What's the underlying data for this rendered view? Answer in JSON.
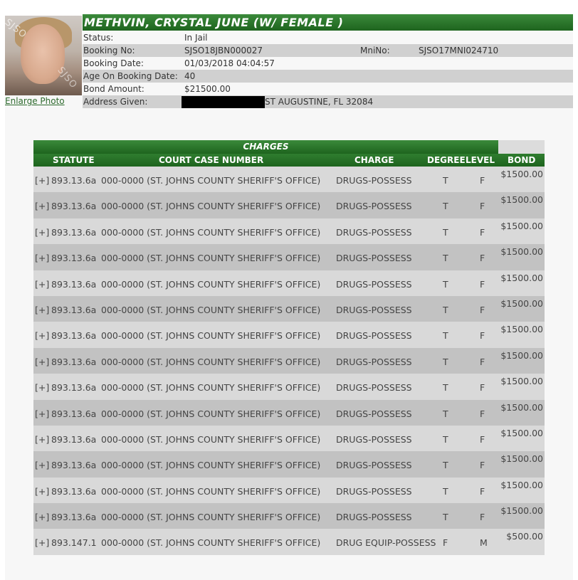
{
  "inmate": {
    "name_header": "METHVIN, CRYSTAL JUNE   (W/ FEMALE )",
    "enlarge_link": "Enlarge Photo",
    "photo_watermark_1": "SJSO",
    "photo_watermark_2": "SJSO",
    "fields": {
      "status_label": "Status:",
      "status_value": "In Jail",
      "booking_no_label": "Booking No:",
      "booking_no_value": "SJSO18JBN000027",
      "mni_label": "MniNo:",
      "mni_value": "SJSO17MNI024710",
      "booking_date_label": "Booking Date:",
      "booking_date_value": "01/03/2018 04:04:57",
      "age_label": "Age On Booking Date:",
      "age_value": "40",
      "bond_label": "Bond Amount:",
      "bond_value": "$21500.00",
      "address_label": "Address Given:",
      "address_value": "ST AUGUSTINE, FL 32084"
    }
  },
  "charges": {
    "title": "CHARGES",
    "headers": {
      "statute": "STATUTE",
      "case": "COURT CASE NUMBER",
      "charge": "CHARGE",
      "degree": "DEGREE",
      "level": "LEVEL",
      "bond": "BOND"
    },
    "rows": [
      {
        "toggle": "[+]",
        "statute": "893.13.6a",
        "case": "000-0000 (ST. JOHNS COUNTY SHERIFF'S OFFICE)",
        "charge": "DRUGS-POSSESS",
        "degree": "T",
        "level": "F",
        "bond": "$1500.00"
      },
      {
        "toggle": "[+]",
        "statute": "893.13.6a",
        "case": "000-0000 (ST. JOHNS COUNTY SHERIFF'S OFFICE)",
        "charge": "DRUGS-POSSESS",
        "degree": "T",
        "level": "F",
        "bond": "$1500.00"
      },
      {
        "toggle": "[+]",
        "statute": "893.13.6a",
        "case": "000-0000 (ST. JOHNS COUNTY SHERIFF'S OFFICE)",
        "charge": "DRUGS-POSSESS",
        "degree": "T",
        "level": "F",
        "bond": "$1500.00"
      },
      {
        "toggle": "[+]",
        "statute": "893.13.6a",
        "case": "000-0000 (ST. JOHNS COUNTY SHERIFF'S OFFICE)",
        "charge": "DRUGS-POSSESS",
        "degree": "T",
        "level": "F",
        "bond": "$1500.00"
      },
      {
        "toggle": "[+]",
        "statute": "893.13.6a",
        "case": "000-0000 (ST. JOHNS COUNTY SHERIFF'S OFFICE)",
        "charge": "DRUGS-POSSESS",
        "degree": "T",
        "level": "F",
        "bond": "$1500.00"
      },
      {
        "toggle": "[+]",
        "statute": "893.13.6a",
        "case": "000-0000 (ST. JOHNS COUNTY SHERIFF'S OFFICE)",
        "charge": "DRUGS-POSSESS",
        "degree": "T",
        "level": "F",
        "bond": "$1500.00"
      },
      {
        "toggle": "[+]",
        "statute": "893.13.6a",
        "case": "000-0000 (ST. JOHNS COUNTY SHERIFF'S OFFICE)",
        "charge": "DRUGS-POSSESS",
        "degree": "T",
        "level": "F",
        "bond": "$1500.00"
      },
      {
        "toggle": "[+]",
        "statute": "893.13.6a",
        "case": "000-0000 (ST. JOHNS COUNTY SHERIFF'S OFFICE)",
        "charge": "DRUGS-POSSESS",
        "degree": "T",
        "level": "F",
        "bond": "$1500.00"
      },
      {
        "toggle": "[+]",
        "statute": "893.13.6a",
        "case": "000-0000 (ST. JOHNS COUNTY SHERIFF'S OFFICE)",
        "charge": "DRUGS-POSSESS",
        "degree": "T",
        "level": "F",
        "bond": "$1500.00"
      },
      {
        "toggle": "[+]",
        "statute": "893.13.6a",
        "case": "000-0000 (ST. JOHNS COUNTY SHERIFF'S OFFICE)",
        "charge": "DRUGS-POSSESS",
        "degree": "T",
        "level": "F",
        "bond": "$1500.00"
      },
      {
        "toggle": "[+]",
        "statute": "893.13.6a",
        "case": "000-0000 (ST. JOHNS COUNTY SHERIFF'S OFFICE)",
        "charge": "DRUGS-POSSESS",
        "degree": "T",
        "level": "F",
        "bond": "$1500.00"
      },
      {
        "toggle": "[+]",
        "statute": "893.13.6a",
        "case": "000-0000 (ST. JOHNS COUNTY SHERIFF'S OFFICE)",
        "charge": "DRUGS-POSSESS",
        "degree": "T",
        "level": "F",
        "bond": "$1500.00"
      },
      {
        "toggle": "[+]",
        "statute": "893.13.6a",
        "case": "000-0000 (ST. JOHNS COUNTY SHERIFF'S OFFICE)",
        "charge": "DRUGS-POSSESS",
        "degree": "T",
        "level": "F",
        "bond": "$1500.00"
      },
      {
        "toggle": "[+]",
        "statute": "893.13.6a",
        "case": "000-0000 (ST. JOHNS COUNTY SHERIFF'S OFFICE)",
        "charge": "DRUGS-POSSESS",
        "degree": "T",
        "level": "F",
        "bond": "$1500.00"
      },
      {
        "toggle": "[+]",
        "statute": "893.147.1",
        "case": "000-0000 (ST. JOHNS COUNTY SHERIFF'S OFFICE)",
        "charge": "DRUG EQUIP-POSSESS",
        "degree": "F",
        "level": "M",
        "bond": "$500.00"
      }
    ]
  },
  "colors": {
    "header_green": "#1e641e",
    "row_light": "#d9d9d9",
    "row_dark": "#c2c2c2",
    "link_green": "#2e6b2e"
  }
}
